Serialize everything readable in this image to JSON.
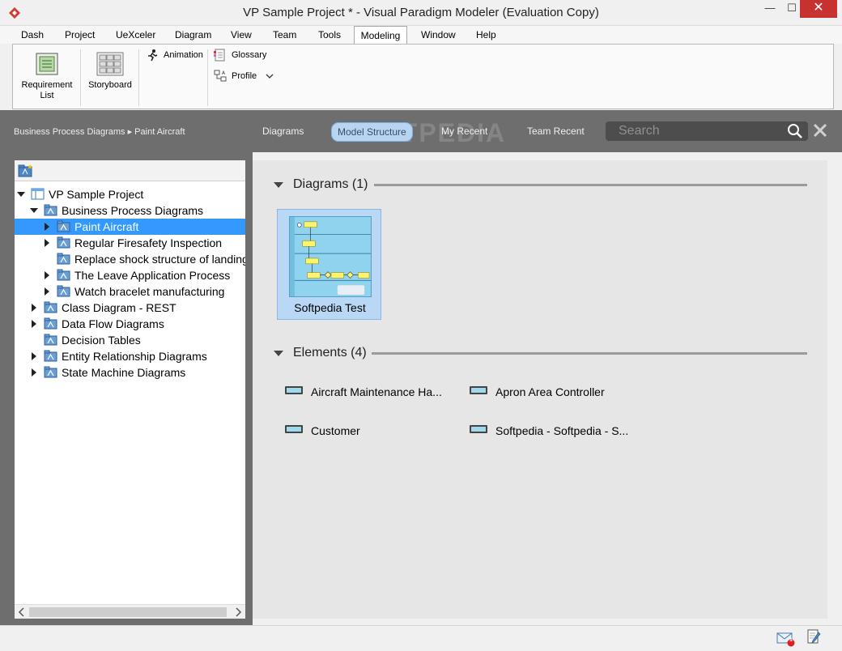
{
  "window": {
    "title": "VP Sample Project * - Visual Paradigm Modeler (Evaluation Copy)",
    "min_glyph": "—",
    "max_glyph": "☐",
    "close_glyph": "✕"
  },
  "menu": {
    "tabs": [
      "Dash",
      "Project",
      "UeXceler",
      "Diagram",
      "View",
      "Team",
      "Tools",
      "Modeling",
      "Window",
      "Help"
    ],
    "active": "Modeling"
  },
  "ribbon": {
    "requirement_list": "Requirement List",
    "storyboard": "Storyboard",
    "animation": "Animation",
    "glossary": "Glossary",
    "profile": "Profile"
  },
  "navbar": {
    "breadcrumb": "Business Process Diagrams ▸ Paint Aircraft",
    "tabs": [
      "Diagrams",
      "Model Structure",
      "My Recent",
      "Team Recent"
    ],
    "active_tab": "Model Structure",
    "search_placeholder": "Search",
    "watermark": "SOFTPEDIA"
  },
  "tree": {
    "items": [
      {
        "label": "VP Sample Project",
        "level": 0,
        "expander": "down",
        "icon": "project-icon"
      },
      {
        "label": "Business Process Diagrams",
        "level": 1,
        "expander": "down",
        "icon": "folder-diagram-icon"
      },
      {
        "label": "Paint Aircraft",
        "level": 2,
        "expander": "right",
        "icon": "folder-diagram-icon",
        "selected": true
      },
      {
        "label": "Regular Firesafety Inspection",
        "level": 2,
        "expander": "right",
        "icon": "folder-diagram-icon"
      },
      {
        "label": "Replace shock structure of landing",
        "level": 2,
        "expander": "none",
        "icon": "folder-diagram-icon"
      },
      {
        "label": "The Leave Application Process",
        "level": 2,
        "expander": "right",
        "icon": "folder-diagram-icon"
      },
      {
        "label": "Watch bracelet manufacturing",
        "level": 2,
        "expander": "right",
        "icon": "folder-diagram-icon"
      },
      {
        "label": "Class Diagram - REST",
        "level": 1,
        "expander": "right",
        "icon": "folder-diagram-icon"
      },
      {
        "label": "Data Flow Diagrams",
        "level": 1,
        "expander": "right",
        "icon": "folder-diagram-icon"
      },
      {
        "label": "Decision Tables",
        "level": 1,
        "expander": "none",
        "icon": "folder-diagram-icon"
      },
      {
        "label": "Entity Relationship Diagrams",
        "level": 1,
        "expander": "right",
        "icon": "folder-diagram-icon"
      },
      {
        "label": "State Machine Diagrams",
        "level": 1,
        "expander": "right",
        "icon": "folder-diagram-icon"
      }
    ]
  },
  "content": {
    "diagrams_header": "Diagrams (1)",
    "diagram_card_label": "Softpedia Test",
    "elements_header": "Elements (4)",
    "elements": [
      "Aircraft Maintenance Ha...",
      "Apron Area Controller",
      "Customer",
      "Softpedia - Softpedia - S..."
    ]
  },
  "status": {
    "notification_count": "1"
  },
  "colors": {
    "selection": "#3399ff",
    "navbar": "#6e6e6e",
    "active_tab_bg": "#b8d4f0",
    "close_button": "#c7312f"
  }
}
